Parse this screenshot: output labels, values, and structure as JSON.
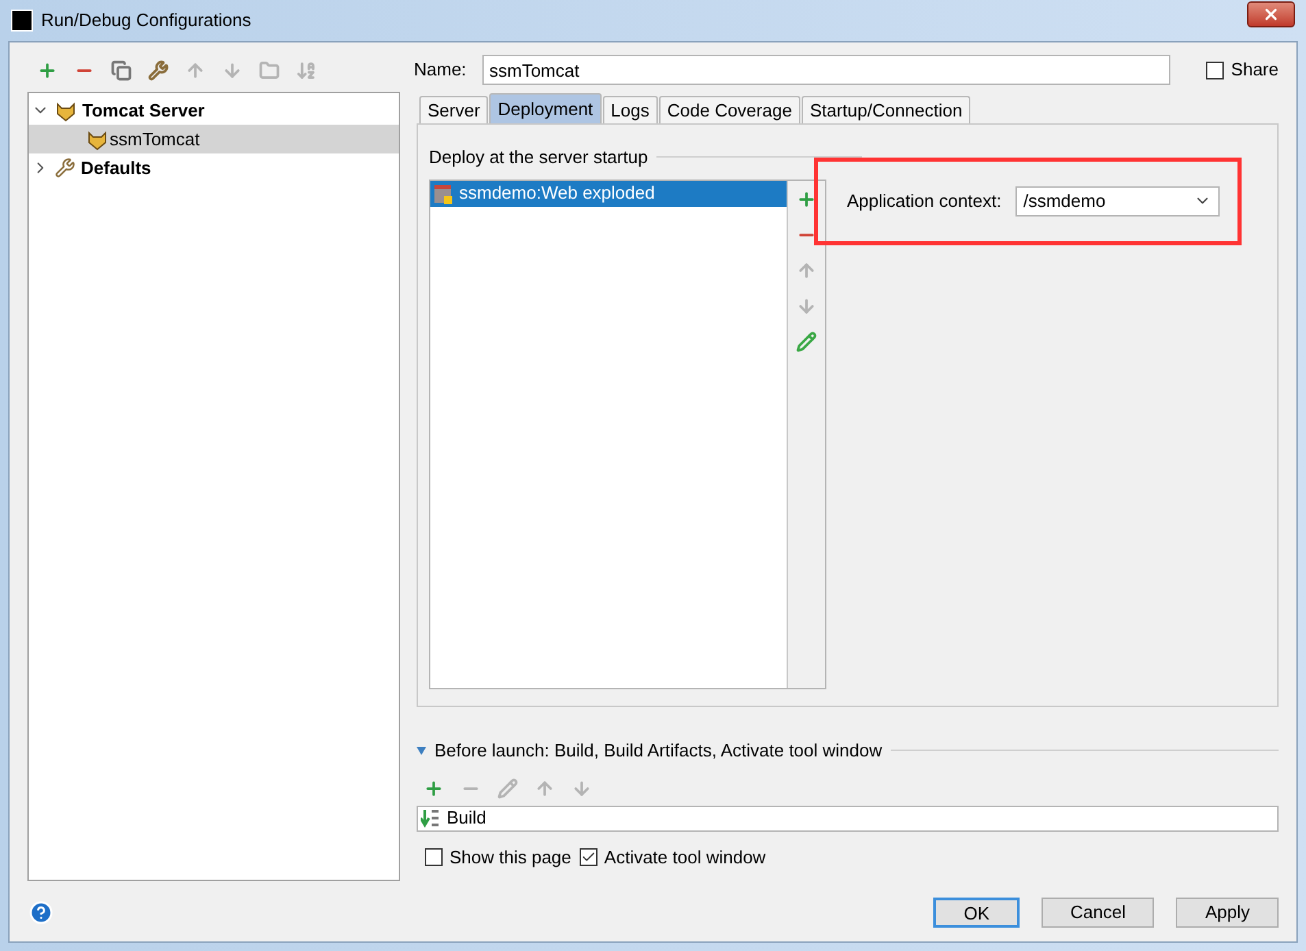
{
  "window": {
    "title": "Run/Debug Configurations"
  },
  "toolbar": [
    {
      "kind": "add",
      "disabled": false
    },
    {
      "kind": "remove",
      "disabled": false
    },
    {
      "kind": "copy",
      "disabled": false
    },
    {
      "kind": "wrench",
      "disabled": false
    },
    {
      "kind": "up",
      "disabled": true
    },
    {
      "kind": "down",
      "disabled": true
    },
    {
      "kind": "folder",
      "disabled": true
    },
    {
      "kind": "sort",
      "disabled": true
    }
  ],
  "tree": [
    {
      "label": "Tomcat Server",
      "kind": "tomcat",
      "expanded": true,
      "selected": false,
      "children": [
        {
          "label": "ssmTomcat",
          "kind": "tomcat",
          "selected": true
        }
      ]
    },
    {
      "label": "Defaults",
      "kind": "wrench",
      "expanded": false,
      "selected": false
    }
  ],
  "name_field": {
    "label": "Name:",
    "value": "ssmTomcat"
  },
  "share": {
    "label": "Share",
    "checked": false
  },
  "tabs": [
    {
      "label": "Server",
      "selected": false
    },
    {
      "label": "Deployment",
      "selected": true
    },
    {
      "label": "Logs",
      "selected": false
    },
    {
      "label": "Code Coverage",
      "selected": false
    },
    {
      "label": "Startup/Connection",
      "selected": false
    }
  ],
  "deploy": {
    "title": "Deploy at the server startup",
    "artifacts": [
      {
        "label": "ssmdemo:Web exploded",
        "selected": true
      }
    ],
    "toolbar": [
      {
        "kind": "add",
        "disabled": false
      },
      {
        "kind": "remove",
        "disabled": false
      },
      {
        "kind": "up",
        "disabled": true
      },
      {
        "kind": "down",
        "disabled": true
      },
      {
        "kind": "edit",
        "disabled": false
      }
    ],
    "context_label": "Application context:",
    "context_value": "/ssmdemo"
  },
  "before_launch": {
    "expanded": true,
    "title": "Before launch: Build, Build Artifacts, Activate tool window",
    "toolbar": [
      {
        "kind": "add",
        "disabled": false
      },
      {
        "kind": "remove",
        "disabled": true
      },
      {
        "kind": "edit",
        "disabled": true
      },
      {
        "kind": "up",
        "disabled": true
      },
      {
        "kind": "down",
        "disabled": true
      }
    ],
    "tasks": [
      {
        "label": "Build"
      }
    ],
    "options": [
      {
        "label": "Show this page",
        "checked": false
      },
      {
        "label": "Activate tool window",
        "checked": true
      }
    ]
  },
  "buttons": [
    {
      "label": "OK",
      "default": true
    },
    {
      "label": "Cancel",
      "default": false
    },
    {
      "label": "Apply",
      "default": false
    }
  ]
}
